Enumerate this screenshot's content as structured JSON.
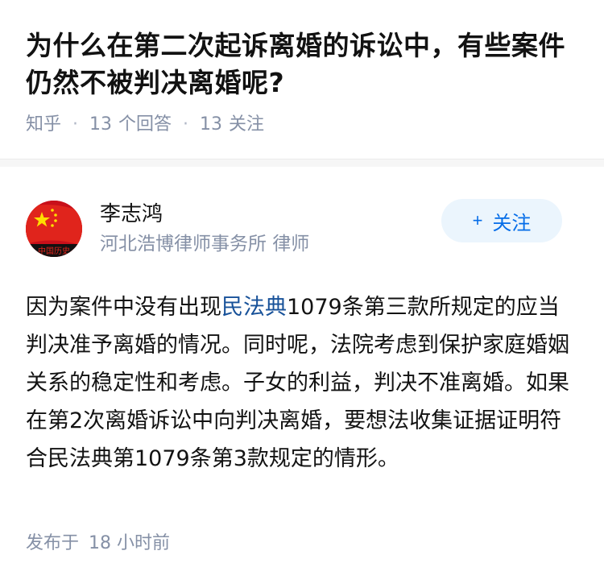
{
  "question": {
    "title": "为什么在第二次起诉离婚的诉讼中，有些案件仍然不被判决离婚呢?",
    "source": "知乎",
    "answers_count": "13",
    "answers_label": "个回答",
    "followers_count": "13",
    "followers_label": "关注"
  },
  "author": {
    "name": "李志鸿",
    "headline": "河北浩博律师事务所 律师",
    "follow_plus": "+",
    "follow_label": "关注",
    "avatar_text": "中国历史"
  },
  "answer": {
    "text_before": "因为案件中没有出现",
    "link_text": "民法典",
    "text_after": "1079条第三款所规定的应当判决准予离婚的情况。同时呢，法院考虑到保护家庭婚姻关系的稳定性和考虑。子女的利益，判决不准离婚。如果在第2次离婚诉讼中向判决离婚，要想法收集证据证明符合民法典第1079条第3款规定的情形。"
  },
  "footer": {
    "label": "发布于",
    "time": "18 小时前"
  },
  "colors": {
    "accent": "#056de8",
    "link": "#175199",
    "meta": "#8590a6"
  }
}
